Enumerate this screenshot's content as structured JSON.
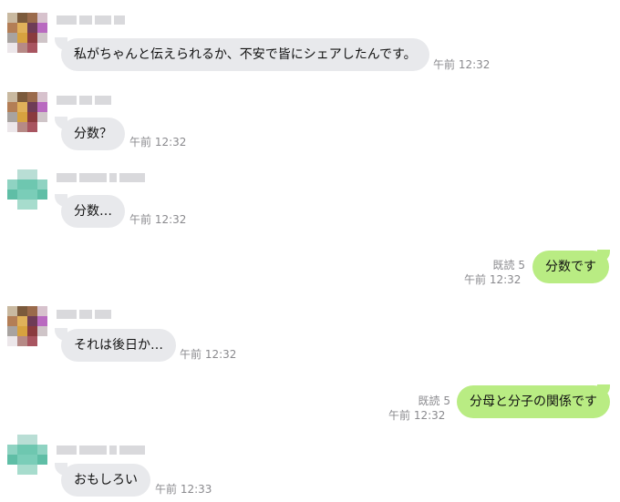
{
  "messages": [
    {
      "side": "in",
      "avatar": "a",
      "text": "私がちゃんと伝えられるか、不安で皆にシェアしたんです。",
      "time": "午前 12:32"
    },
    {
      "side": "in",
      "avatar": "a",
      "text": "分数？",
      "time": "午前 12:32"
    },
    {
      "side": "in",
      "avatar": "b",
      "text": "分数…",
      "time": "午前 12:32"
    },
    {
      "side": "out",
      "text": "分数です",
      "read": "既読 5",
      "time": "午前 12:32"
    },
    {
      "side": "in",
      "avatar": "a",
      "text": "それは後日か…",
      "time": "午前 12:32"
    },
    {
      "side": "out",
      "text": "分母と分子の関係です",
      "read": "既読 5",
      "time": "午前 12:32"
    },
    {
      "side": "in",
      "avatar": "b",
      "text": "おもしろい",
      "time": "午前 12:33"
    }
  ],
  "colors": {
    "incoming_bubble": "#e8e9ec",
    "outgoing_bubble": "#b9ec83",
    "meta_text": "#8a8a8e"
  }
}
